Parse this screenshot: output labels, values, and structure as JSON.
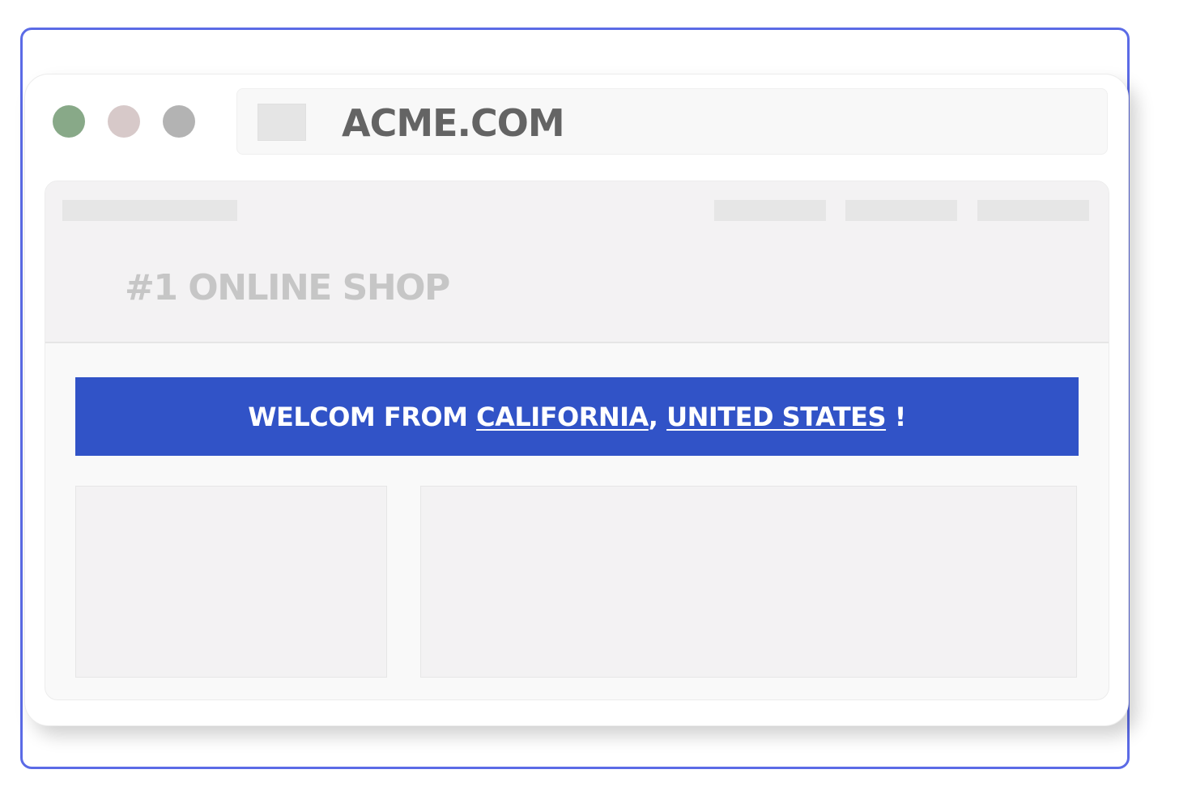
{
  "browser": {
    "url": "ACME.COM",
    "traffic_lights": [
      "green",
      "pink",
      "gray"
    ]
  },
  "page": {
    "tagline": "#1 ONLINE SHOP",
    "banner": {
      "prefix": "WELCOM FROM ",
      "region": "CALIFORNIA",
      "separator": ", ",
      "country": "UNITED STATES",
      "suffix": " !",
      "color": "#3153c7"
    }
  },
  "colors": {
    "frame_border": "#5b6be6",
    "green_dot": "#88a988",
    "pink_dot": "#d7c9c9",
    "gray_dot": "#b3b3b3"
  }
}
